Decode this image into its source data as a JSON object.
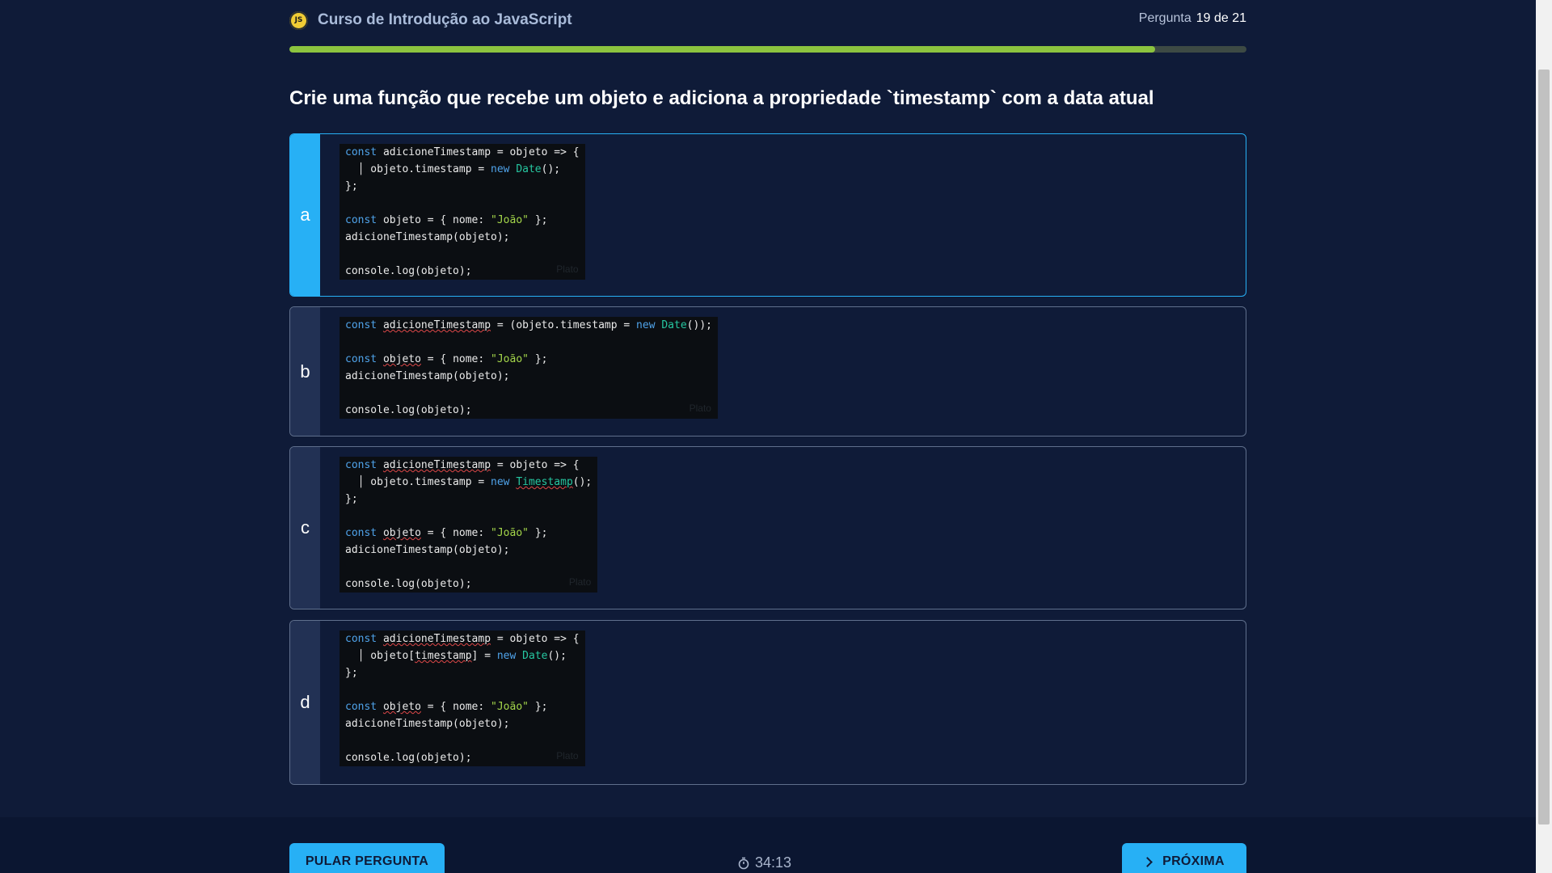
{
  "header": {
    "course_title": "Curso de Introdução ao JavaScript",
    "badge_text": "JS",
    "progress_label": "Pergunta",
    "progress_value": "19 de 21",
    "progress_fraction": 0.9048,
    "progress_color": "#8cc43f"
  },
  "question": {
    "text": "Crie uma função que recebe um objeto e adiciona a propriedade `timestamp` com a data atual"
  },
  "options": [
    {
      "letter": "a",
      "selected": true,
      "watermark": "Plato",
      "lines": [
        [
          {
            "t": "const",
            "c": "kw"
          },
          {
            "t": " adicioneTimestamp = objeto => {"
          }
        ],
        [
          {
            "t": "  │ objeto.timestamp = "
          },
          {
            "t": "new",
            "c": "kw"
          },
          {
            "t": " "
          },
          {
            "t": "Date",
            "c": "cls"
          },
          {
            "t": "();"
          }
        ],
        [
          {
            "t": "};"
          }
        ],
        [
          {
            "t": ""
          }
        ],
        [
          {
            "t": "const",
            "c": "kw"
          },
          {
            "t": " objeto = { nome: "
          },
          {
            "t": "\"João\"",
            "c": "str"
          },
          {
            "t": " };"
          }
        ],
        [
          {
            "t": "adicioneTimestamp(objeto);"
          }
        ],
        [
          {
            "t": ""
          }
        ],
        [
          {
            "t": "console.log(objeto);"
          }
        ]
      ]
    },
    {
      "letter": "b",
      "selected": false,
      "watermark": "Plato",
      "lines": [
        [
          {
            "t": "const",
            "c": "kw"
          },
          {
            "t": " "
          },
          {
            "t": "adicioneTimestamp",
            "c": "err"
          },
          {
            "t": " = (objeto.timestamp = "
          },
          {
            "t": "new",
            "c": "kw"
          },
          {
            "t": " "
          },
          {
            "t": "Date",
            "c": "cls"
          },
          {
            "t": "());"
          }
        ],
        [
          {
            "t": ""
          }
        ],
        [
          {
            "t": "const",
            "c": "kw"
          },
          {
            "t": " "
          },
          {
            "t": "objeto",
            "c": "err"
          },
          {
            "t": " = { nome: "
          },
          {
            "t": "\"João\"",
            "c": "str"
          },
          {
            "t": " };"
          }
        ],
        [
          {
            "t": "adicioneTimestamp(objeto);"
          }
        ],
        [
          {
            "t": ""
          }
        ],
        [
          {
            "t": "console.log(objeto);"
          }
        ]
      ]
    },
    {
      "letter": "c",
      "selected": false,
      "watermark": "Plato",
      "lines": [
        [
          {
            "t": "const",
            "c": "kw"
          },
          {
            "t": " "
          },
          {
            "t": "adicioneTimestamp",
            "c": "err"
          },
          {
            "t": " = objeto => {"
          }
        ],
        [
          {
            "t": "  │ objeto.timestamp = "
          },
          {
            "t": "new",
            "c": "kw"
          },
          {
            "t": " "
          },
          {
            "t": "Timestamp",
            "c": "cls err"
          },
          {
            "t": "();"
          }
        ],
        [
          {
            "t": "};"
          }
        ],
        [
          {
            "t": ""
          }
        ],
        [
          {
            "t": "const",
            "c": "kw"
          },
          {
            "t": " "
          },
          {
            "t": "objeto",
            "c": "err"
          },
          {
            "t": " = { nome: "
          },
          {
            "t": "\"João\"",
            "c": "str"
          },
          {
            "t": " };"
          }
        ],
        [
          {
            "t": "adicioneTimestamp(objeto);"
          }
        ],
        [
          {
            "t": ""
          }
        ],
        [
          {
            "t": "console.log(objeto);"
          }
        ]
      ]
    },
    {
      "letter": "d",
      "selected": false,
      "watermark": "Plato",
      "lines": [
        [
          {
            "t": "const",
            "c": "kw"
          },
          {
            "t": " "
          },
          {
            "t": "adicioneTimestamp",
            "c": "err"
          },
          {
            "t": " = objeto => {"
          }
        ],
        [
          {
            "t": "  │ objeto["
          },
          {
            "t": "timestamp",
            "c": "err"
          },
          {
            "t": "] = "
          },
          {
            "t": "new",
            "c": "kw"
          },
          {
            "t": " "
          },
          {
            "t": "Date",
            "c": "cls"
          },
          {
            "t": "();"
          }
        ],
        [
          {
            "t": "};"
          }
        ],
        [
          {
            "t": ""
          }
        ],
        [
          {
            "t": "const",
            "c": "kw"
          },
          {
            "t": " "
          },
          {
            "t": "objeto",
            "c": "err"
          },
          {
            "t": " = { nome: "
          },
          {
            "t": "\"João\"",
            "c": "str"
          },
          {
            "t": " };"
          }
        ],
        [
          {
            "t": "adicioneTimestamp(objeto);"
          }
        ],
        [
          {
            "t": ""
          }
        ],
        [
          {
            "t": "console.log(objeto);"
          }
        ]
      ]
    }
  ],
  "footer": {
    "skip_label": "PULAR PERGUNTA",
    "timer": "34:13",
    "next_label": "PRÓXIMA"
  },
  "colors": {
    "accent": "#27b0f5",
    "background": "#0f1b38"
  }
}
